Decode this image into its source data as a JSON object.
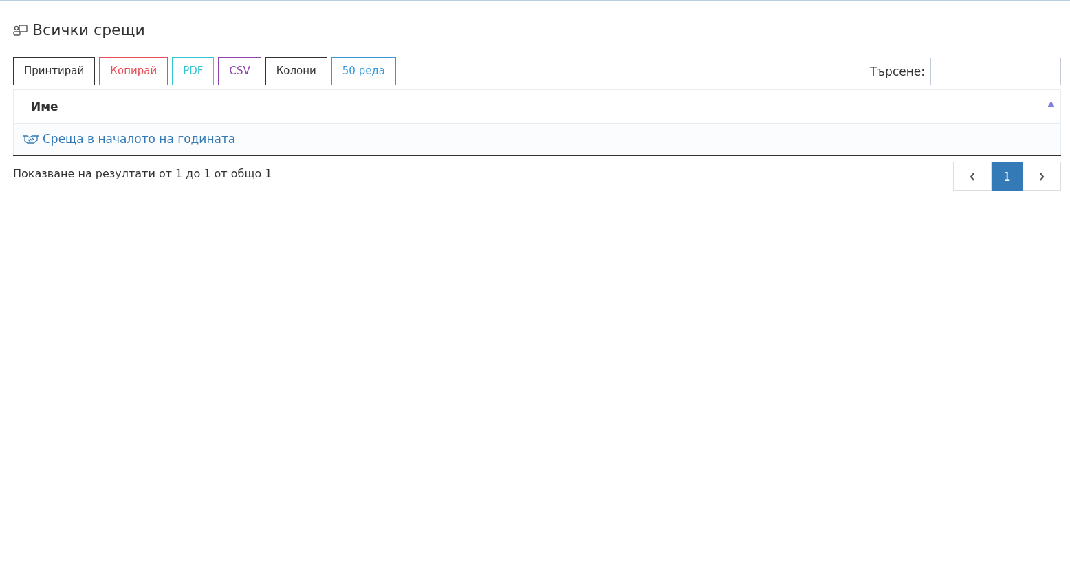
{
  "title": "Всички срещи",
  "buttons": [
    {
      "label": "Принтирай",
      "color": "#333333"
    },
    {
      "label": "Копирай",
      "color": "#e7505a"
    },
    {
      "label": "PDF",
      "color": "#32c5d2"
    },
    {
      "label": "CSV",
      "color": "#8e44ad"
    },
    {
      "label": "Колони",
      "color": "#333333"
    },
    {
      "label": "50 реда",
      "color": "#3598dc"
    }
  ],
  "search": {
    "label": "Търсене:"
  },
  "table": {
    "columns": [
      {
        "label": "Име",
        "sorted_ascending": true
      }
    ],
    "rows": [
      {
        "name": "Среща в началото на годината"
      }
    ]
  },
  "info": "Показване на резултати от 1 до 1 от общо 1",
  "pagination": {
    "pages": [
      {
        "label": "1",
        "selected": true
      }
    ]
  }
}
